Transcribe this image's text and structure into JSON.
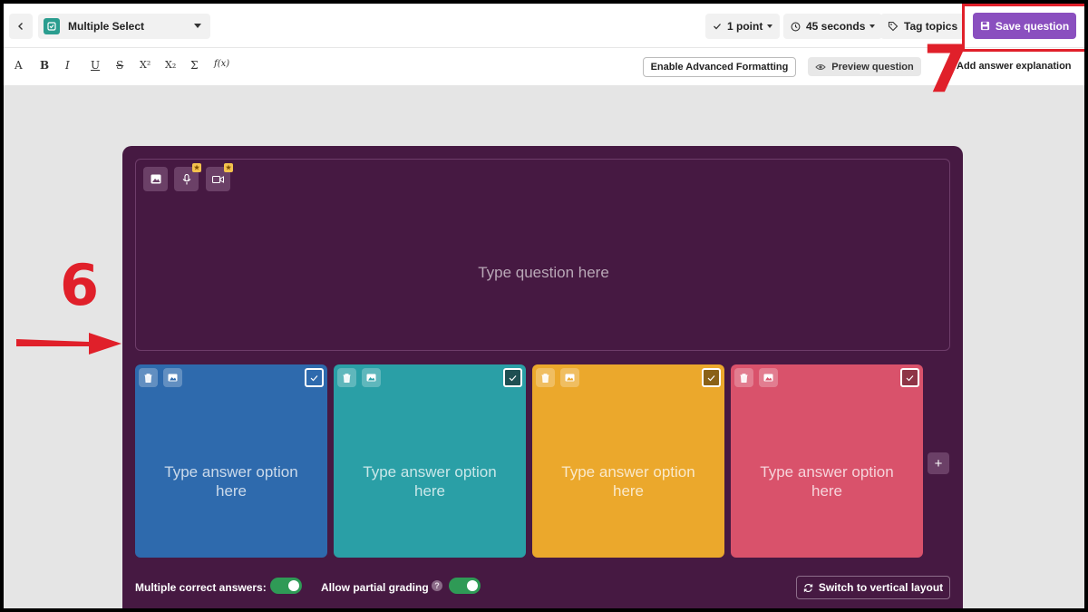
{
  "header": {
    "question_type": "Multiple Select",
    "points": "1 point",
    "time": "45 seconds",
    "tag_topics": "Tag topics",
    "save": "Save question"
  },
  "format_bar": {
    "tools": [
      "A",
      "B",
      "I",
      "U",
      "S",
      "X²",
      "X₂",
      "Σ",
      "f(x)"
    ],
    "enable_advanced": "Enable Advanced Formatting",
    "preview": "Preview question",
    "add_explanation": "Add answer explanation"
  },
  "annotations": {
    "step_6": "6",
    "step_7": "7"
  },
  "question": {
    "placeholder": "Type question here",
    "media_buttons": [
      "image-icon",
      "mic-icon",
      "video-icon"
    ]
  },
  "options": [
    {
      "placeholder": "Type answer option here",
      "color": "#2e6aad"
    },
    {
      "placeholder": "Type answer option here",
      "color": "#2a9fa6"
    },
    {
      "placeholder": "Type answer option here",
      "color": "#eba82c"
    },
    {
      "placeholder": "Type answer option here",
      "color": "#d9526b"
    }
  ],
  "settings": {
    "multiple_correct_label": "Multiple correct answers:",
    "multiple_correct_on": true,
    "partial_grading_label": "Allow partial grading",
    "partial_grading_on": true,
    "switch_layout": "Switch to vertical layout"
  },
  "colors": {
    "card_bg": "#461942",
    "accent": "#8a4fbf",
    "annotation_red": "#e0202a",
    "toggle_on": "#2f9a56"
  }
}
